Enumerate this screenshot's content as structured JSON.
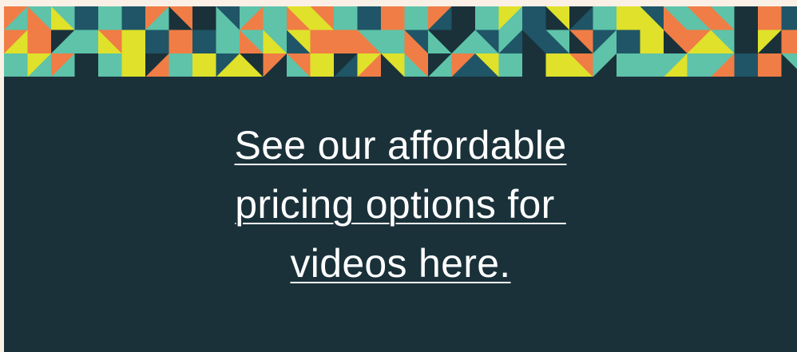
{
  "colors": {
    "background": "#1a313a",
    "page_edge": "#fbf0e6",
    "text": "#ffffff",
    "pattern_orange": "#f07d45",
    "pattern_yellow": "#dfe12a",
    "pattern_teal": "#5ec3a9",
    "pattern_blue": "#1f5566",
    "pattern_dark": "#1a313a"
  },
  "cta": {
    "lines": [
      "See our affordable",
      "pricing options for ",
      "videos here."
    ]
  }
}
